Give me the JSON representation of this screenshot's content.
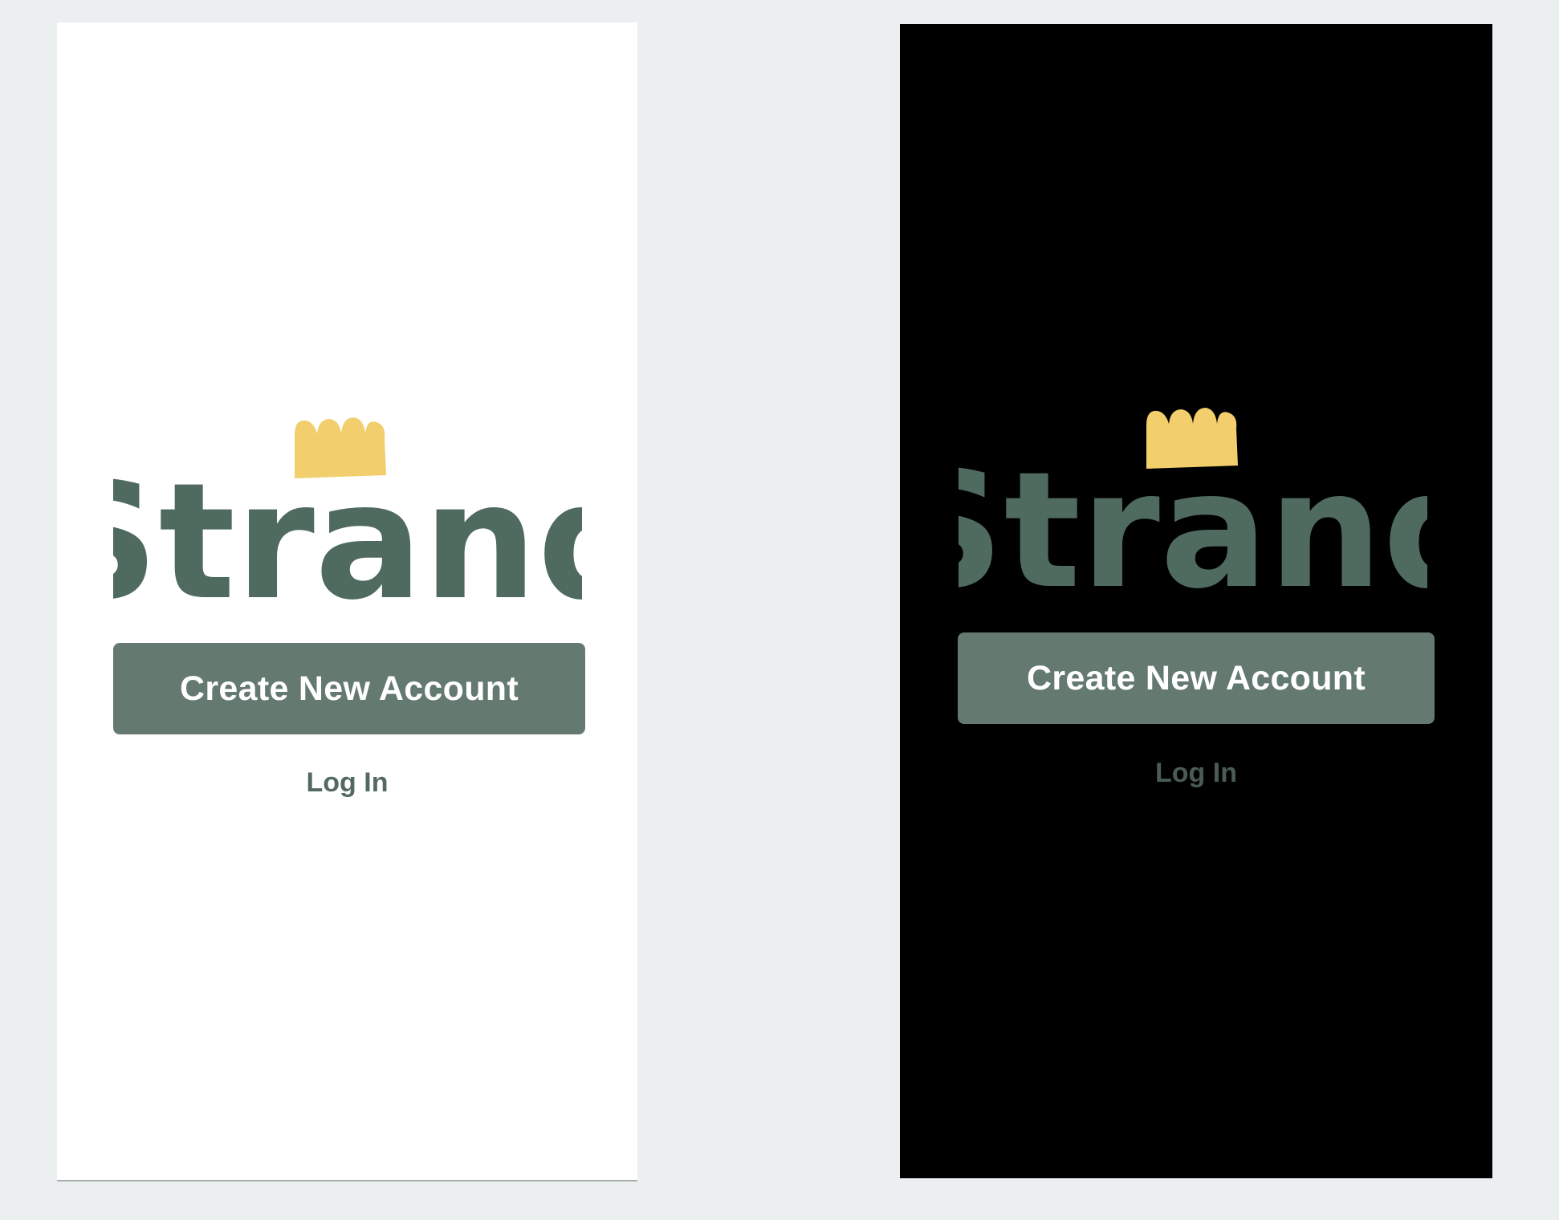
{
  "brand": {
    "name": "Strand",
    "primary_color": "#4f6a5f",
    "accent_color": "#f2cf6c",
    "button_color": "#64796f"
  },
  "screens": [
    {
      "theme": "light",
      "background": "#ffffff",
      "create_account_label": "Create New Account",
      "login_label": "Log In"
    },
    {
      "theme": "dark",
      "background": "#000000",
      "create_account_label": "Create New Account",
      "login_label": "Log In"
    }
  ]
}
